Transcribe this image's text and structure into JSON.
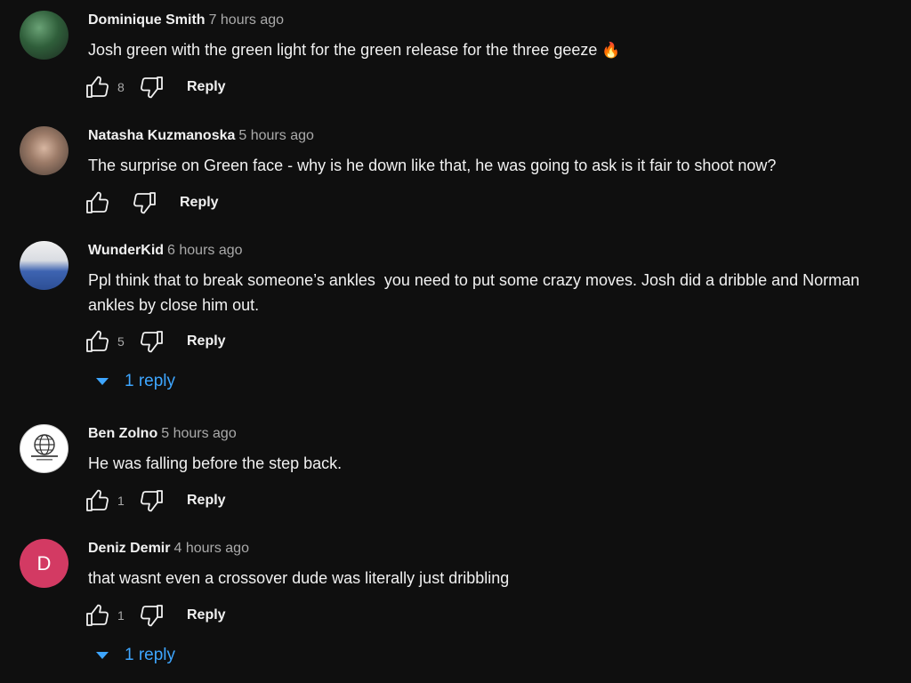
{
  "comments": [
    {
      "author": "Dominique Smith",
      "time": "7 hours ago",
      "text": "Josh green with the green light for the green release for the three geeze",
      "emoji": "🔥",
      "likes": "8",
      "reply_label": "Reply"
    },
    {
      "author": "Natasha Kuzmanoska",
      "time": "5 hours ago",
      "text": "The surprise on Green face - why is he down like that, he was going to ask is it fair to shoot now?",
      "likes": "",
      "reply_label": "Reply"
    },
    {
      "author": "WunderKid",
      "time": "6 hours ago",
      "text": "Ppl think that to break someone’s ankles  you need to put some crazy moves. Josh did a dribble and Norman\nankles by close him out.",
      "likes": "5",
      "reply_label": "Reply",
      "replies_label": "1 reply"
    },
    {
      "author": "Ben Zolno",
      "time": "5 hours ago",
      "text": "He was falling before the step back.",
      "likes": "1",
      "reply_label": "Reply"
    },
    {
      "author": "Deniz Demir",
      "time": "4 hours ago",
      "avatar_letter": "D",
      "text": "that wasnt even a crossover dude was literally just dribbling",
      "likes": "1",
      "reply_label": "Reply",
      "replies_label": "1 reply"
    }
  ],
  "icons": {
    "like": "thumbs-up-icon",
    "dislike": "thumbs-down-icon",
    "expand": "caret-down-icon"
  },
  "colors": {
    "background": "#0f0f0f",
    "link": "#3ea6ff",
    "avatar_deniz": "#d33a63"
  }
}
